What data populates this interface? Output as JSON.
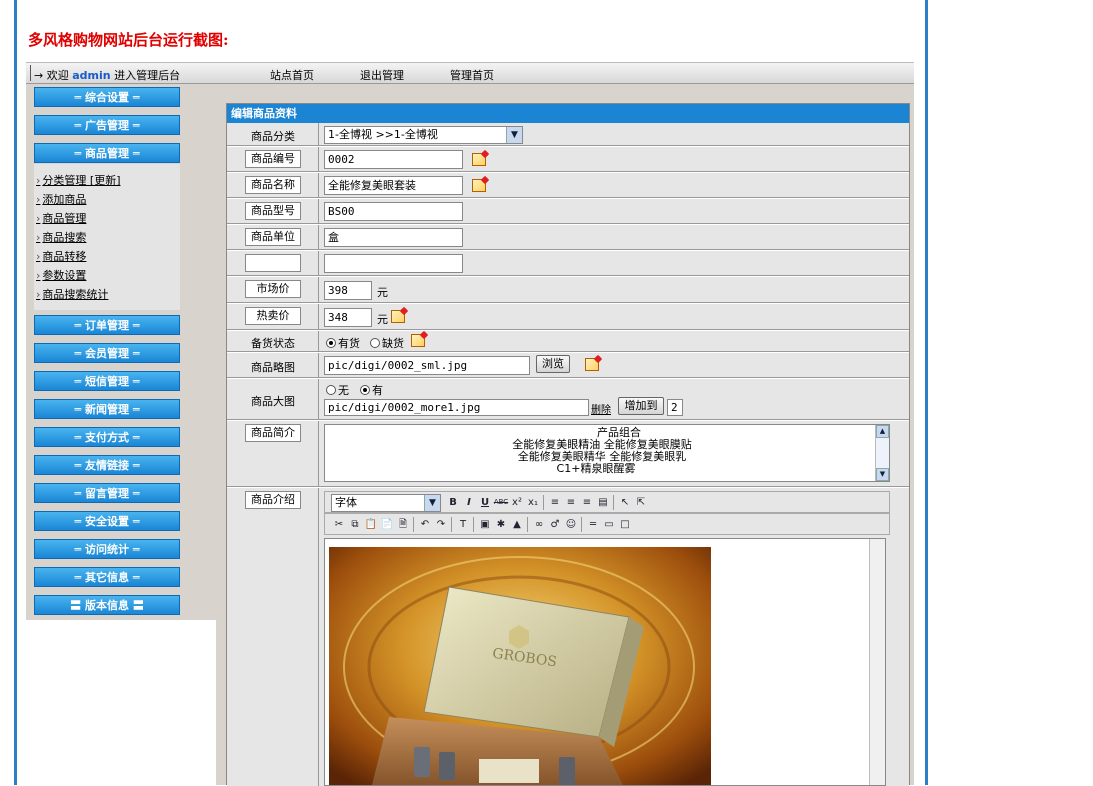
{
  "caption": "多风格购物网站后台运行截图:",
  "topbar": {
    "welcome_prefix": "→ 欢迎",
    "admin_name": "admin",
    "welcome_suffix": "进入管理后台",
    "nav": [
      "站点首页",
      "退出管理",
      "管理首页"
    ]
  },
  "sidebar": {
    "menus": [
      "═ 综合设置 ═",
      "═ 广告管理 ═",
      "═ 商品管理 ═",
      "═ 订单管理 ═",
      "═ 会员管理 ═",
      "═ 短信管理 ═",
      "═ 新闻管理 ═",
      "═ 支付方式 ═",
      "═ 友情链接 ═",
      "═ 留言管理 ═",
      "═ 安全设置 ═",
      "═ 访问统计 ═",
      "═ 其它信息 ═",
      "〓 版本信息 〓"
    ],
    "sub_items": [
      "分类管理 [更新]",
      "添加商品",
      "商品管理",
      "商品搜索",
      "商品转移",
      "参数设置",
      "商品搜索统计"
    ]
  },
  "panel": {
    "title": "编辑商品资料",
    "category_label": "商品分类",
    "category_value": "1-全博视 >>1-全博视",
    "code_label": "商品编号",
    "code_value": "0002",
    "name_label": "商品名称",
    "name_value": "全能修复美眼套装",
    "model_label": "商品型号",
    "model_value": "BS00",
    "unit_label": "商品单位",
    "unit_value": "盒",
    "blank_label": "",
    "blank_value": "",
    "market_label": "市场价",
    "market_value": "398",
    "yuan": "元",
    "hot_label": "热卖价",
    "hot_value": "348",
    "stock_label": "备货状态",
    "stock_yes": "有货",
    "stock_no": "缺货",
    "thumb_label": "商品略图",
    "thumb_value": "pic/digi/0002_sml.jpg",
    "browse_label": "浏览",
    "bigimg_label": "商品大图",
    "bigimg_none": "无",
    "bigimg_have": "有",
    "bigimg_value": "pic/digi/0002_more1.jpg",
    "delete_label": "删除",
    "addto_label": "增加到",
    "addto_value": "2",
    "brief_label": "商品简介",
    "brief_lines": [
      "产品组合",
      "全能修复美眼精油  全能修复美眼膜贴",
      "全能修复美眼精华  全能修复美眼乳",
      "C1+精泉眼醒雾"
    ],
    "intro_label": "商品介绍",
    "font_select": "字体"
  }
}
